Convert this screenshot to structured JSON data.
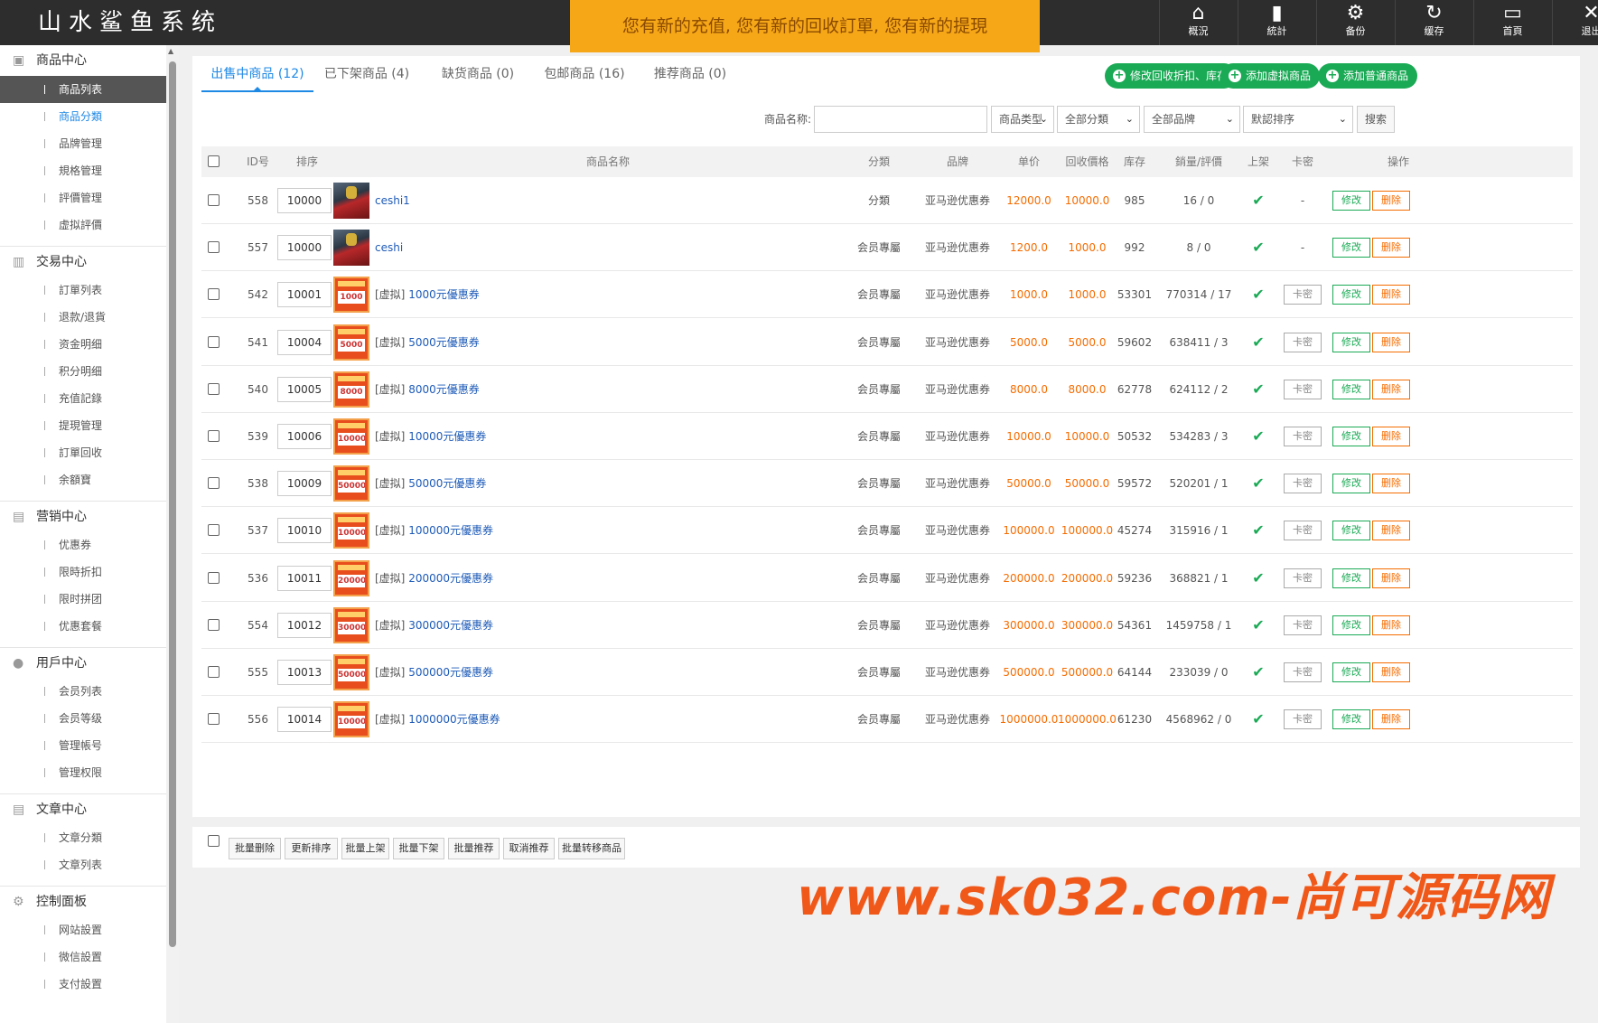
{
  "app_title": "山水鲨鱼系统",
  "notice": "您有新的充值, 您有新的回收訂單, 您有新的提現",
  "top_nav": [
    {
      "label": "概況",
      "icon": "home-icon"
    },
    {
      "label": "統計",
      "icon": "bar-chart-icon"
    },
    {
      "label": "备份",
      "icon": "gear-icon"
    },
    {
      "label": "缓存",
      "icon": "refresh-icon"
    },
    {
      "label": "首頁",
      "icon": "monitor-icon"
    },
    {
      "label": "退出",
      "icon": "close-icon"
    }
  ],
  "sidebar": {
    "groups": [
      {
        "title": "商品中心",
        "icon": "box-icon",
        "items": [
          "商品列表",
          "商品分類",
          "品牌管理",
          "規格管理",
          "評價管理",
          "虚拟評價"
        ]
      },
      {
        "title": "交易中心",
        "icon": "bar-chart-icon",
        "items": [
          "訂單列表",
          "退款/退貨",
          "资金明细",
          "积分明细",
          "充值記錄",
          "提現管理",
          "訂單回收",
          "余額寶"
        ]
      },
      {
        "title": "营销中心",
        "icon": "chart-icon",
        "items": [
          "优惠券",
          "限時折扣",
          "限时拼团",
          "优惠套餐"
        ]
      },
      {
        "title": "用戶中心",
        "icon": "user-icon",
        "items": [
          "会员列表",
          "会员等级",
          "管理帳号",
          "管理权限"
        ]
      },
      {
        "title": "文章中心",
        "icon": "document-icon",
        "items": [
          "文章分類",
          "文章列表"
        ]
      },
      {
        "title": "控制面板",
        "icon": "gear-icon",
        "items": [
          "网站設置",
          "微信設置",
          "支付設置"
        ]
      }
    ]
  },
  "tabs": [
    {
      "label": "出售中商品 (12)"
    },
    {
      "label": "已下架商品 (4)"
    },
    {
      "label": "缺货商品 (0)"
    },
    {
      "label": "包邮商品 (16)"
    },
    {
      "label": "推荐商品 (0)"
    }
  ],
  "action_buttons": [
    "修改回收折扣、库存",
    "添加虚拟商品",
    "添加普通商品"
  ],
  "search": {
    "name_label": "商品名称:",
    "name_value": "",
    "type_select": "商品类型",
    "category_select": "全部分類",
    "brand_select": "全部品牌",
    "sort_select": "默認排序",
    "search_button": "搜索"
  },
  "table": {
    "headers": [
      "ID号",
      "排序",
      "商品名称",
      "分類",
      "品牌",
      "单价",
      "回收價格",
      "库存",
      "銷量/評價",
      "上架",
      "卡密",
      "操作"
    ],
    "edit_label": "修改",
    "delete_label": "删除",
    "kami_label": "卡密",
    "rows": [
      {
        "id": "558",
        "sort": "10000",
        "thumb": "hero",
        "thumb_text": "",
        "prefix": "",
        "name": "ceshi1",
        "category": "分類",
        "brand": "亚马逊优惠券",
        "price": "12000.0",
        "recycle": "10000.0",
        "stock": "985",
        "sales": "16 / 0",
        "listed": "✔",
        "kami": "-"
      },
      {
        "id": "557",
        "sort": "10000",
        "thumb": "hero",
        "thumb_text": "",
        "prefix": "",
        "name": "ceshi",
        "category": "会员專屬",
        "brand": "亚马逊优惠券",
        "price": "1200.0",
        "recycle": "1000.0",
        "stock": "992",
        "sales": "8 / 0",
        "listed": "✔",
        "kami": "-"
      },
      {
        "id": "542",
        "sort": "10001",
        "thumb": "coupon",
        "thumb_text": "1000",
        "prefix": "[虚拟] ",
        "name": "1000元優惠券",
        "category": "会员專屬",
        "brand": "亚马逊优惠券",
        "price": "1000.0",
        "recycle": "1000.0",
        "stock": "53301",
        "sales": "770314 / 17",
        "listed": "✔",
        "kami": "卡密"
      },
      {
        "id": "541",
        "sort": "10004",
        "thumb": "coupon",
        "thumb_text": "5000",
        "prefix": "[虚拟] ",
        "name": "5000元優惠券",
        "category": "会员專屬",
        "brand": "亚马逊优惠券",
        "price": "5000.0",
        "recycle": "5000.0",
        "stock": "59602",
        "sales": "638411 / 3",
        "listed": "✔",
        "kami": "卡密"
      },
      {
        "id": "540",
        "sort": "10005",
        "thumb": "coupon",
        "thumb_text": "8000",
        "prefix": "[虚拟] ",
        "name": "8000元優惠券",
        "category": "会员專屬",
        "brand": "亚马逊优惠券",
        "price": "8000.0",
        "recycle": "8000.0",
        "stock": "62778",
        "sales": "624112 / 2",
        "listed": "✔",
        "kami": "卡密"
      },
      {
        "id": "539",
        "sort": "10006",
        "thumb": "coupon",
        "thumb_text": "10000",
        "prefix": "[虚拟] ",
        "name": "10000元優惠券",
        "category": "会员專屬",
        "brand": "亚马逊优惠券",
        "price": "10000.0",
        "recycle": "10000.0",
        "stock": "50532",
        "sales": "534283 / 3",
        "listed": "✔",
        "kami": "卡密"
      },
      {
        "id": "538",
        "sort": "10009",
        "thumb": "coupon",
        "thumb_text": "50000",
        "prefix": "[虚拟] ",
        "name": "50000元優惠券",
        "category": "会员專屬",
        "brand": "亚马逊优惠券",
        "price": "50000.0",
        "recycle": "50000.0",
        "stock": "59572",
        "sales": "520201 / 1",
        "listed": "✔",
        "kami": "卡密"
      },
      {
        "id": "537",
        "sort": "10010",
        "thumb": "coupon",
        "thumb_text": "100000",
        "prefix": "[虚拟] ",
        "name": "100000元優惠券",
        "category": "会员專屬",
        "brand": "亚马逊优惠券",
        "price": "100000.0",
        "recycle": "100000.0",
        "stock": "45274",
        "sales": "315916 / 1",
        "listed": "✔",
        "kami": "卡密"
      },
      {
        "id": "536",
        "sort": "10011",
        "thumb": "coupon",
        "thumb_text": "200000",
        "prefix": "[虚拟] ",
        "name": "200000元優惠券",
        "category": "会员專屬",
        "brand": "亚马逊优惠券",
        "price": "200000.0",
        "recycle": "200000.0",
        "stock": "59236",
        "sales": "368821 / 1",
        "listed": "✔",
        "kami": "卡密"
      },
      {
        "id": "554",
        "sort": "10012",
        "thumb": "coupon",
        "thumb_text": "300000",
        "prefix": "[虚拟] ",
        "name": "300000元優惠券",
        "category": "会员專屬",
        "brand": "亚马逊优惠券",
        "price": "300000.0",
        "recycle": "300000.0",
        "stock": "54361",
        "sales": "1459758 / 1",
        "listed": "✔",
        "kami": "卡密"
      },
      {
        "id": "555",
        "sort": "10013",
        "thumb": "coupon",
        "thumb_text": "500000",
        "prefix": "[虚拟] ",
        "name": "500000元優惠券",
        "category": "会员專屬",
        "brand": "亚马逊优惠券",
        "price": "500000.0",
        "recycle": "500000.0",
        "stock": "64144",
        "sales": "233039 / 0",
        "listed": "✔",
        "kami": "卡密"
      },
      {
        "id": "556",
        "sort": "10014",
        "thumb": "coupon",
        "thumb_text": "1000000",
        "prefix": "[虚拟] ",
        "name": "1000000元優惠券",
        "category": "会员專屬",
        "brand": "亚马逊优惠券",
        "price": "1000000.0",
        "recycle": "1000000.0",
        "stock": "61230",
        "sales": "4568962 / 0",
        "listed": "✔",
        "kami": "卡密"
      }
    ]
  },
  "bulk_buttons": [
    "批量删除",
    "更新排序",
    "批量上架",
    "批量下架",
    "批量推荐",
    "取消推荐",
    "批量转移商品"
  ],
  "watermark": "www.sk032.com-尚可源码网",
  "colors": {
    "accent": "#1e88e5",
    "green": "#1aaa55",
    "orange": "#f56c00",
    "notice_bg": "#f6a718",
    "topbar": "#2d2d2d"
  }
}
